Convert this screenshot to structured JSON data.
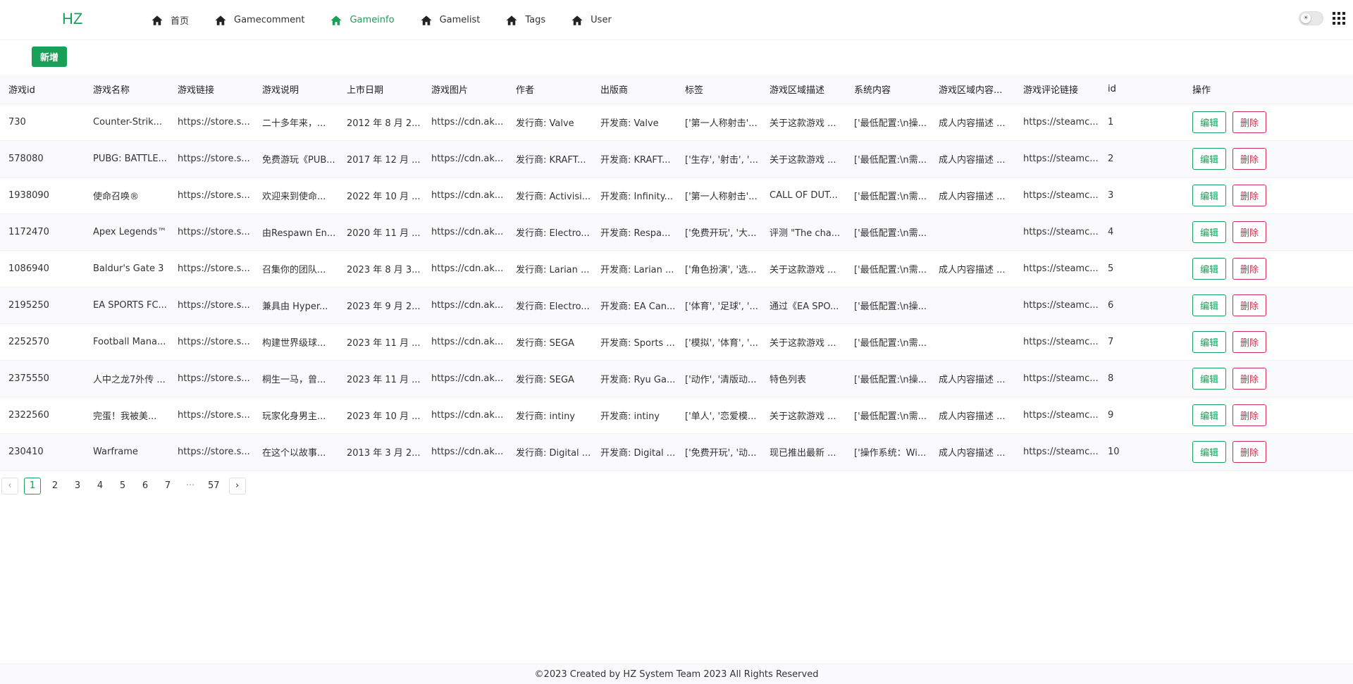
{
  "header": {
    "logo": "HZ",
    "nav": [
      {
        "label": "首页",
        "active": false
      },
      {
        "label": "Gamecomment",
        "active": false
      },
      {
        "label": "Gameinfo",
        "active": true
      },
      {
        "label": "Gamelist",
        "active": false
      },
      {
        "label": "Tags",
        "active": false
      },
      {
        "label": "User",
        "active": false
      }
    ],
    "theme_icon": "☀"
  },
  "toolbar": {
    "add_label": "新增"
  },
  "table": {
    "columns": [
      "游戏id",
      "游戏名称",
      "游戏链接",
      "游戏说明",
      "上市日期",
      "游戏图片",
      "作者",
      "出版商",
      "标签",
      "游戏区域描述",
      "系统内容",
      "游戏区域内容...",
      "游戏评论链接",
      "id",
      "操作"
    ],
    "rows": [
      [
        "730",
        "Counter-Strik...",
        "https://store.s...",
        "二十多年来，...",
        "2012 年 8 月 2...",
        "https://cdn.ak...",
        "发行商: Valve",
        "开发商: Valve",
        "['第一人称射击'...",
        "关于这款游戏 ...",
        "['最低配置:\\n操...",
        "成人内容描述 ...",
        "https://steamc...",
        "1"
      ],
      [
        "578080",
        "PUBG: BATTLE...",
        "https://store.s...",
        "免费游玩《PUB...",
        "2017 年 12 月 ...",
        "https://cdn.ak...",
        "发行商: KRAFT...",
        "开发商: KRAFT...",
        "['生存', '射击', '...",
        "关于这款游戏 ...",
        "['最低配置:\\n需...",
        "成人内容描述 ...",
        "https://steamc...",
        "2"
      ],
      [
        "1938090",
        "使命召唤®",
        "https://store.s...",
        "欢迎来到使命...",
        "2022 年 10 月 ...",
        "https://cdn.ak...",
        "发行商: Activisi...",
        "开发商: Infinity...",
        "['第一人称射击'...",
        "CALL OF DUT...",
        "['最低配置:\\n需...",
        "成人内容描述 ...",
        "https://steamc...",
        "3"
      ],
      [
        "1172470",
        "Apex Legends™",
        "https://store.s...",
        "由Respawn En...",
        "2020 年 11 月 ...",
        "https://cdn.ak...",
        "发行商: Electro...",
        "开发商: Respa...",
        "['免费开玩', '大...",
        "评测 \"The cha...",
        "['最低配置:\\n需...",
        "",
        "https://steamc...",
        "4"
      ],
      [
        "1086940",
        "Baldur's Gate 3",
        "https://store.s...",
        "召集你的团队...",
        "2023 年 8 月 3...",
        "https://cdn.ak...",
        "发行商: Larian ...",
        "开发商: Larian ...",
        "['角色扮演', '选...",
        "关于这款游戏 ...",
        "['最低配置:\\n需...",
        "成人内容描述 ...",
        "https://steamc...",
        "5"
      ],
      [
        "2195250",
        "EA SPORTS FC...",
        "https://store.s...",
        "兼具由 Hyper...",
        "2023 年 9 月 2...",
        "https://cdn.ak...",
        "发行商: Electro...",
        "开发商: EA Can...",
        "['体育', '足球', '...",
        "通过《EA SPO...",
        "['最低配置:\\n操...",
        "",
        "https://steamc...",
        "6"
      ],
      [
        "2252570",
        "Football Mana...",
        "https://store.s...",
        "构建世界级球...",
        "2023 年 11 月 ...",
        "https://cdn.ak...",
        "发行商: SEGA",
        "开发商: Sports ...",
        "['模拟', '体育', '...",
        "关于这款游戏 ...",
        "['最低配置:\\n需...",
        "",
        "https://steamc...",
        "7"
      ],
      [
        "2375550",
        "人中之龙7外传 ...",
        "https://store.s...",
        "桐生一马，曾...",
        "2023 年 11 月 ...",
        "https://cdn.ak...",
        "发行商: SEGA",
        "开发商: Ryu Ga...",
        "['动作', '清版动...",
        "特色列表",
        "['最低配置:\\n操...",
        "成人内容描述 ...",
        "https://steamc...",
        "8"
      ],
      [
        "2322560",
        "完蛋！我被美...",
        "https://store.s...",
        "玩家化身男主...",
        "2023 年 10 月 ...",
        "https://cdn.ak...",
        "发行商: intiny",
        "开发商: intiny",
        "['单人', '恋爱模...",
        "关于这款游戏 ...",
        "['最低配置:\\n需...",
        "成人内容描述 ...",
        "https://steamc...",
        "9"
      ],
      [
        "230410",
        "Warframe",
        "https://store.s...",
        "在这个以故事...",
        "2013 年 3 月 2...",
        "https://cdn.ak...",
        "发行商: Digital ...",
        "开发商: Digital ...",
        "['免费开玩', '动...",
        "现已推出最新 ...",
        "['操作系统：Wi...",
        "成人内容描述 ...",
        "https://steamc...",
        "10"
      ]
    ],
    "edit_label": "编辑",
    "delete_label": "删除"
  },
  "pagination": {
    "prev": "‹",
    "pages": [
      "1",
      "2",
      "3",
      "4",
      "5",
      "6",
      "7",
      "···",
      "57"
    ],
    "current": "1",
    "next": "›"
  },
  "footer": {
    "text": "©2023 Created by HZ System Team 2023 All Rights Reserved"
  },
  "colors": {
    "accent": "#18a058",
    "danger": "#d03050"
  }
}
